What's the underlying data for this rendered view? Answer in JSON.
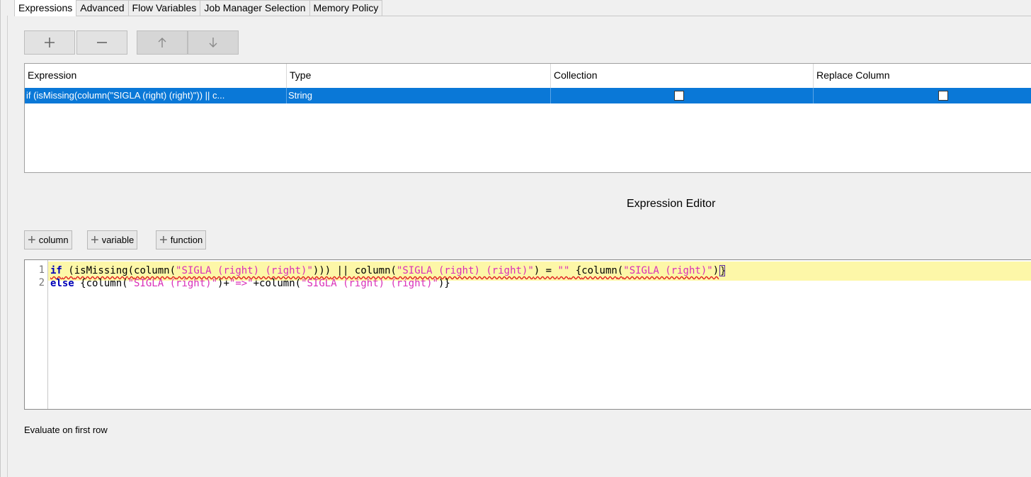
{
  "tabs": [
    {
      "label": "Expressions",
      "active": true
    },
    {
      "label": "Advanced",
      "active": false
    },
    {
      "label": "Flow Variables",
      "active": false
    },
    {
      "label": "Job Manager Selection",
      "active": false
    },
    {
      "label": "Memory Policy",
      "active": false
    }
  ],
  "toolbar": {
    "add_icon": "plus-icon",
    "remove_icon": "minus-icon",
    "up_icon": "arrow-up-icon",
    "down_icon": "arrow-down-icon"
  },
  "table": {
    "columns": [
      "Expression",
      "Type",
      "Collection",
      "Replace Column"
    ],
    "rows": [
      {
        "expression": "if (isMissing(column(\"SIGLA (right) (right)\")) || c...",
        "type": "String",
        "collection": false,
        "replace_column": false
      }
    ],
    "selection_color": "#0a78d7"
  },
  "editor": {
    "title": "Expression Editor",
    "insert_buttons": [
      "column",
      "variable",
      "function"
    ],
    "line_numbers": [
      "1",
      "2"
    ],
    "line1": {
      "t1": "if",
      "t2": " (",
      "t3": "isMissing",
      "t4": "(",
      "t5": "column",
      "t6": "(",
      "t7": "\"SIGLA (right) (right)\"",
      "t8": ")))",
      "t9": " || ",
      "t10": "column",
      "t11": "(",
      "t12": "\"SIGLA (right) (right)\"",
      "t13": ") = ",
      "t14": "\"\"",
      "t15": " {",
      "t16": "column",
      "t17": "(",
      "t18": "\"SIGLA (right)\"",
      "t19": ")",
      "t20": "}"
    },
    "line2": {
      "t1": "else",
      "t2": " {",
      "t3": "column",
      "t4": "(",
      "t5": "\"SIGLA (right)\"",
      "t6": ")+",
      "t7": "\"=>\"",
      "t8": "+",
      "t9": "column",
      "t10": "(",
      "t11": "\"SIGLA (right) (right)\"",
      "t12": ")}"
    }
  },
  "footer": {
    "evaluate_label": "Evaluate on first row"
  }
}
